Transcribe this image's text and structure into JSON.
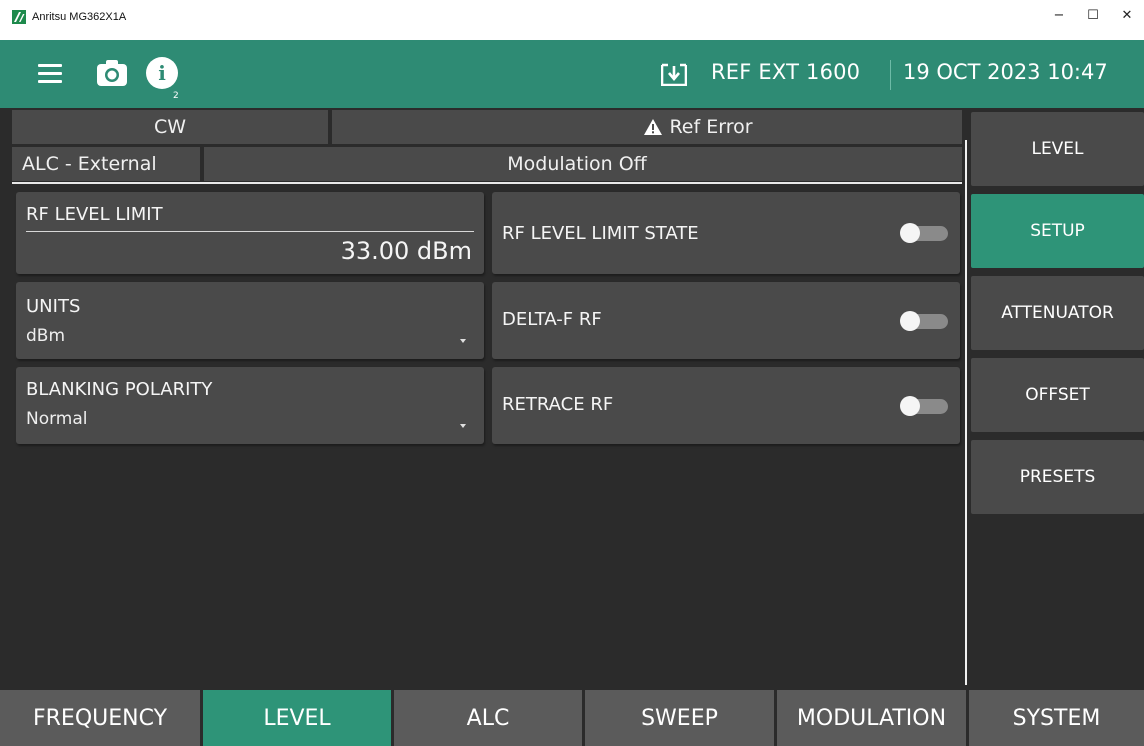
{
  "window": {
    "title": "Anritsu MG362X1A",
    "controls": {
      "minimize": "−",
      "maximize": "☐",
      "close": "✕"
    }
  },
  "header": {
    "info_badge": "2",
    "reference": "REF EXT 1600",
    "datetime": "19 OCT 2023 10:47",
    "icons": [
      "menu-icon",
      "camera-icon",
      "info-icon",
      "ref-download-icon"
    ]
  },
  "status": {
    "mode": "CW",
    "error": "Ref Error",
    "alc": "ALC - External",
    "modulation": "Modulation Off"
  },
  "params": {
    "rf_level_limit": {
      "label": "RF LEVEL LIMIT",
      "value": "33.00 dBm"
    },
    "units": {
      "label": "UNITS",
      "value": "dBm"
    },
    "blanking_polarity": {
      "label": "BLANKING POLARITY",
      "value": "Normal"
    },
    "rf_level_limit_state": {
      "label": "RF LEVEL LIMIT STATE",
      "on": false
    },
    "delta_f_rf": {
      "label": "DELTA-F RF",
      "on": false
    },
    "retrace_rf": {
      "label": "RETRACE RF",
      "on": false
    }
  },
  "side_menu": [
    {
      "label": "LEVEL",
      "active": false
    },
    {
      "label": "SETUP",
      "active": true
    },
    {
      "label": "ATTENUATOR",
      "active": false
    },
    {
      "label": "OFFSET",
      "active": false
    },
    {
      "label": "PRESETS",
      "active": false
    }
  ],
  "tabs": [
    {
      "label": "FREQUENCY",
      "active": false
    },
    {
      "label": "LEVEL",
      "active": true
    },
    {
      "label": "ALC",
      "active": false
    },
    {
      "label": "SWEEP",
      "active": false
    },
    {
      "label": "MODULATION",
      "active": false
    },
    {
      "label": "SYSTEM",
      "active": false
    }
  ],
  "colors": {
    "accent": "#2e9478",
    "header": "#2e8b74",
    "background": "#2b2b2b",
    "card": "#4a4a4a",
    "tab": "#5b5b5b"
  }
}
